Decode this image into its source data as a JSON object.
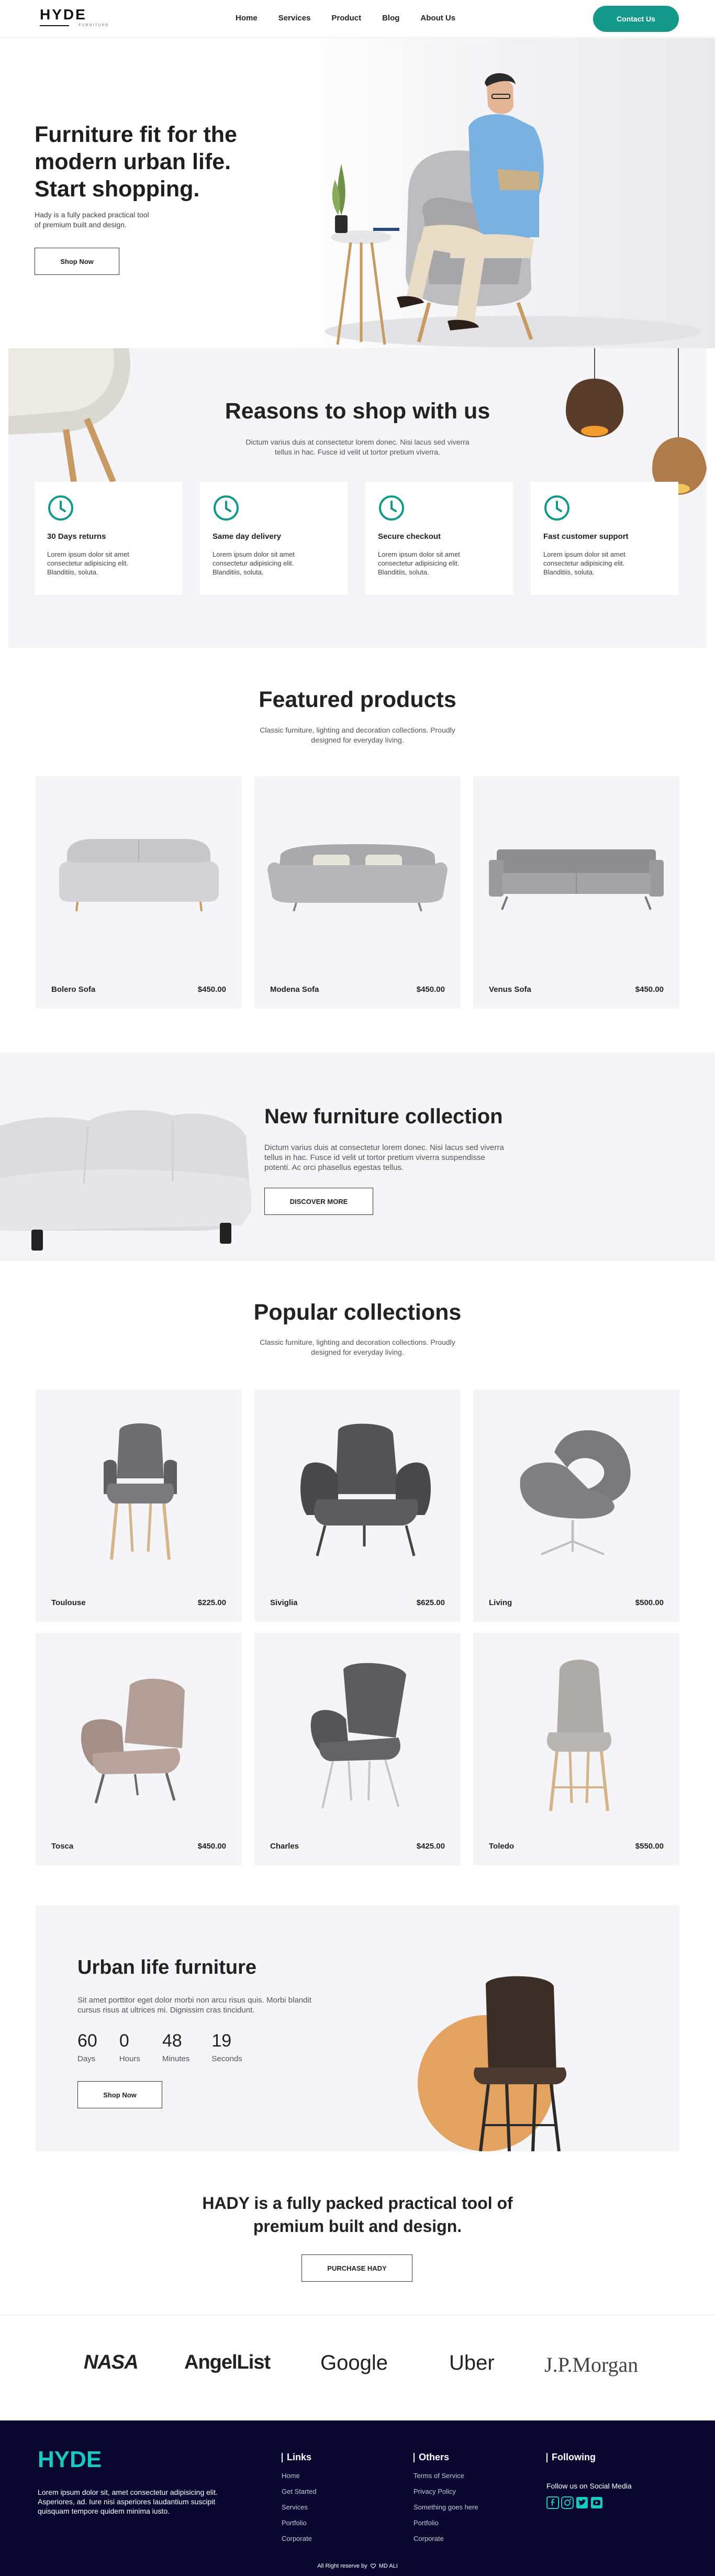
{
  "header": {
    "logo": "HYDE",
    "logo_sub": "FURNITURE",
    "nav": [
      "Home",
      "Services",
      "Product",
      "Blog",
      "About Us"
    ],
    "contact_label": "Contact Us",
    "accent": "#14988a"
  },
  "hero": {
    "title": "Furniture fit for the modern urban life. Start shopping.",
    "description": "Hady is a fully packed practical tool of premium built and design.",
    "cta": "Shop Now"
  },
  "reasons": {
    "title": "Reasons to shop with us",
    "subtitle": "Dictum varius duis at consectetur lorem donec. Nisi lacus sed viverra tellus in hac. Fusce id velit ut tortor pretium viverra.",
    "items": [
      {
        "title": "30 Days returns",
        "desc": "Lorem ipsum dolor sit amet consectetur adipisicing elit. Blanditiis, soluta."
      },
      {
        "title": "Same day delivery",
        "desc": "Lorem ipsum dolor sit amet consectetur adipisicing elit. Blanditiis, soluta."
      },
      {
        "title": "Secure checkout",
        "desc": "Lorem ipsum dolor sit amet consectetur adipisicing elit. Blanditiis, soluta."
      },
      {
        "title": "Fast customer support",
        "desc": "Lorem ipsum dolor sit amet consectetur adipisicing elit. Blanditiis, soluta."
      }
    ]
  },
  "featured": {
    "title": "Featured products",
    "subtitle": "Classic furniture, lighting and decoration collections. Proudly designed for everyday living.",
    "products": [
      {
        "name": "Bolero Sofa",
        "price": "$450.00"
      },
      {
        "name": "Modena Sofa",
        "price": "$450.00"
      },
      {
        "name": "Venus Sofa",
        "price": "$450.00"
      }
    ]
  },
  "collection_banner": {
    "title": "New furniture collection",
    "desc": "Dictum varius duis at consectetur lorem donec. Nisi lacus sed viverra tellus in hac. Fusce id velit ut tortor pretium viverra suspendisse potenti. Ac orci phasellus egestas tellus.",
    "cta": "DISCOVER MORE"
  },
  "popular": {
    "title": "Popular collections",
    "subtitle": "Classic furniture, lighting and decoration collections. Proudly designed for everyday living.",
    "products": [
      {
        "name": "Toulouse",
        "price": "$225.00"
      },
      {
        "name": "Siviglia",
        "price": "$625.00"
      },
      {
        "name": "Living",
        "price": "$500.00"
      },
      {
        "name": "Tosca",
        "price": "$450.00"
      },
      {
        "name": "Charles",
        "price": "$425.00"
      },
      {
        "name": "Toledo",
        "price": "$550.00"
      }
    ]
  },
  "urban": {
    "title": "Urban life furniture",
    "desc": "Sit amet porttitor eget dolor morbi non arcu risus quis. Morbi blandit cursus risus at ultrices mi. Dignissim cras tincidunt.",
    "countdown": [
      {
        "value": "60",
        "label": "Days"
      },
      {
        "value": "0",
        "label": "Hours"
      },
      {
        "value": "48",
        "label": "Minutes"
      },
      {
        "value": "19",
        "label": "Seconds"
      }
    ],
    "cta": "Shop Now"
  },
  "promo": {
    "title": "HADY is a fully packed practical tool of premium built and design.",
    "cta": "PURCHASE HADY"
  },
  "brands": [
    "NASA",
    "AngelList",
    "Google",
    "Uber",
    "J.P.Morgan"
  ],
  "footer": {
    "logo": "HYDE",
    "about": "Lorem ipsum dolor sit, amet consectetur adipisicing elit. Asperiores, ad. Iure nisi asperiores laudantium suscipit quisquam tempore quidem minima iusto.",
    "links_title": "Links",
    "links": [
      "Home",
      "Get Started",
      "Services",
      "Portfolio",
      "Corporate"
    ],
    "others_title": "Others",
    "others": [
      "Terms of Service",
      "Privacy Policy",
      "Something goes here",
      "Portfolio",
      "Corporate"
    ],
    "following_title": "Following",
    "social_label": "Follow us on Social Media",
    "copyright": "All Right reserve by",
    "copyright_brand": "MD ALI",
    "logo_color": "#19c9c0"
  }
}
